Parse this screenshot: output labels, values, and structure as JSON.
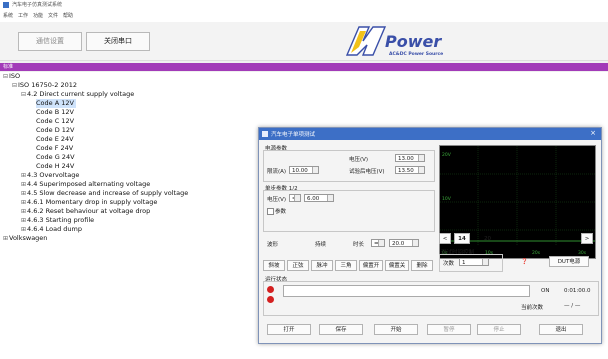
{
  "app": {
    "title": "汽车电子仿真测试系统"
  },
  "menu": [
    "系统",
    "工作",
    "功能",
    "文件",
    "帮助"
  ],
  "toolbar": {
    "connect_label": "通信设置",
    "close_port_label": "关闭串口"
  },
  "logo": {
    "brand": "Power",
    "sub": "AC&DC Power Source"
  },
  "section": {
    "label": "标准"
  },
  "tree": {
    "root": "ISO",
    "std": "ISO 16750-2 2012",
    "dc": "4.2 Direct current supply voltage",
    "codes": [
      "Code A 12V",
      "Code B 12V",
      "Code C 12V",
      "Code D 12V",
      "Code E 24V",
      "Code F 24V",
      "Code G 24V",
      "Code H 24V"
    ],
    "others": [
      "4.3 Overvoltage",
      "4.4 Superimposed alternating voltage",
      "4.5 Slow decrease and increase of supply voltage",
      "4.6.1 Momentary drop in supply voltage",
      "4.6.2 Reset behaviour at voltage drop",
      "4.6.3 Starting profile",
      "4.6.4 Load dump"
    ],
    "vw": "Volkswagen"
  },
  "dialog": {
    "title": "汽车电子单项测试",
    "close": "×",
    "power": {
      "group": "电源参数",
      "voltage_label": "电压(V)",
      "voltage_value": "13.00",
      "current_label": "限流(A)",
      "current_value": "10.00",
      "trigger_label": "试验后电压(V)",
      "trigger_value": "13.50"
    },
    "step": {
      "group": "单步参数 1/2",
      "voltage_label": "电压(V)",
      "op": "=",
      "voltage_value": "6.00",
      "checkbox_label": "参数"
    },
    "timing": {
      "label1": "波形",
      "label2": "持续",
      "label3": "时长",
      "op": "=",
      "duration": "20.0"
    },
    "scope": {
      "y_ticks": [
        "20V",
        "10V",
        "0V"
      ],
      "x_ticks": [
        "0s",
        "10s",
        "20s",
        "30s"
      ]
    },
    "page": {
      "current": "14",
      "next": "20"
    },
    "actions": [
      "斜坡",
      "正弦",
      "脉冲",
      "三角",
      "偏置开",
      "偏置关",
      "删除"
    ],
    "loop": {
      "group": "测试时间控制",
      "count_label": "次数",
      "count_value": "1"
    },
    "dut_label": "DUT电源",
    "run": {
      "group": "运行状态",
      "state": "ON",
      "time": "0:01:00.0",
      "count_label": "当前次数",
      "count_value": "— / —"
    },
    "footer": [
      "打开",
      "保存",
      "开始",
      "暂停",
      "停止",
      "退出"
    ]
  }
}
